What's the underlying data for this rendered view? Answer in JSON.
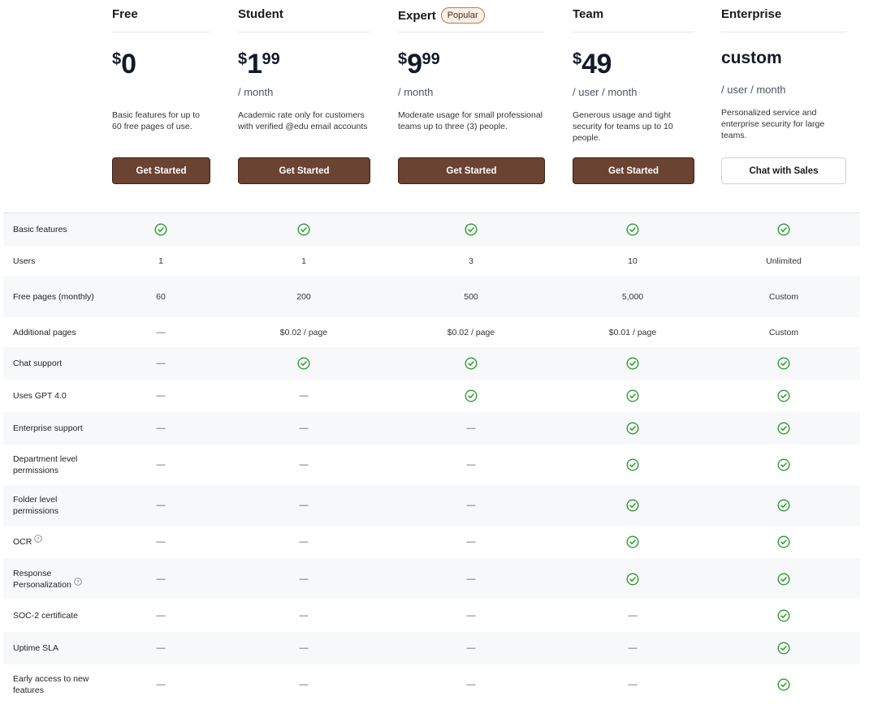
{
  "plans": [
    {
      "name": "Free",
      "price": {
        "currency": "$",
        "amount": "0",
        "cents": ""
      },
      "period": "",
      "description": "Basic features for up to 60 free pages of use.",
      "cta": "Get Started"
    },
    {
      "name": "Student",
      "price": {
        "currency": "$",
        "amount": "1",
        "cents": "99"
      },
      "period": "/ month",
      "description": "Academic rate only for customers with verified @edu email accounts",
      "cta": "Get Started"
    },
    {
      "name": "Expert",
      "badge": "Popular",
      "price": {
        "currency": "$",
        "amount": "9",
        "cents": "99"
      },
      "period": "/ month",
      "description": "Moderate usage for small professional teams up to three (3) people.",
      "cta": "Get Started"
    },
    {
      "name": "Team",
      "price": {
        "currency": "$",
        "amount": "49",
        "cents": ""
      },
      "period": "/ user / month",
      "description": "Generous usage and tight security for teams up to 10 people.",
      "cta": "Get Started"
    },
    {
      "name": "Enterprise",
      "price_text": "custom",
      "period": "/ user / month",
      "description": "Personalized service and enterprise security for large teams.",
      "cta": "Chat with Sales"
    }
  ],
  "dash": "—",
  "features": [
    {
      "label": "Basic features",
      "values": [
        "check",
        "check",
        "check",
        "check",
        "check"
      ]
    },
    {
      "label": "Users",
      "values": [
        "1",
        "1",
        "3",
        "10",
        "Unlimited"
      ]
    },
    {
      "label": "Free pages (monthly)",
      "values": [
        "60",
        "200",
        "500",
        "5,000",
        "Custom"
      ]
    },
    {
      "label": "Additional pages",
      "values": [
        "dash",
        "$0.02 / page",
        "$0.02 / page",
        "$0.01 / page",
        "Custom"
      ]
    },
    {
      "label": "Chat support",
      "values": [
        "dash",
        "check",
        "check",
        "check",
        "check"
      ]
    },
    {
      "label": "Uses GPT 4.0",
      "values": [
        "dash",
        "dash",
        "check",
        "check",
        "check"
      ]
    },
    {
      "label": "Enterprise support",
      "values": [
        "dash",
        "dash",
        "dash",
        "check",
        "check"
      ]
    },
    {
      "label": "Department level permissions",
      "values": [
        "dash",
        "dash",
        "dash",
        "check",
        "check"
      ]
    },
    {
      "label": "Folder level permissions",
      "values": [
        "dash",
        "dash",
        "dash",
        "check",
        "check"
      ]
    },
    {
      "label": "OCR",
      "help": true,
      "values": [
        "dash",
        "dash",
        "dash",
        "check",
        "check"
      ]
    },
    {
      "label": "Response Personalization",
      "help": true,
      "values": [
        "dash",
        "dash",
        "dash",
        "check",
        "check"
      ]
    },
    {
      "label": "SOC-2 certificate",
      "values": [
        "dash",
        "dash",
        "dash",
        "dash",
        "check"
      ]
    },
    {
      "label": "Uptime SLA",
      "values": [
        "dash",
        "dash",
        "dash",
        "dash",
        "check"
      ]
    },
    {
      "label": "Early access to new features",
      "values": [
        "dash",
        "dash",
        "dash",
        "dash",
        "check"
      ]
    }
  ],
  "colors": {
    "button": "#6b4332",
    "check": "#2e9a2e",
    "row_alt": "#f7f8f9"
  },
  "icons": {
    "check": "check-circle-icon",
    "help": "question-circle-icon"
  }
}
